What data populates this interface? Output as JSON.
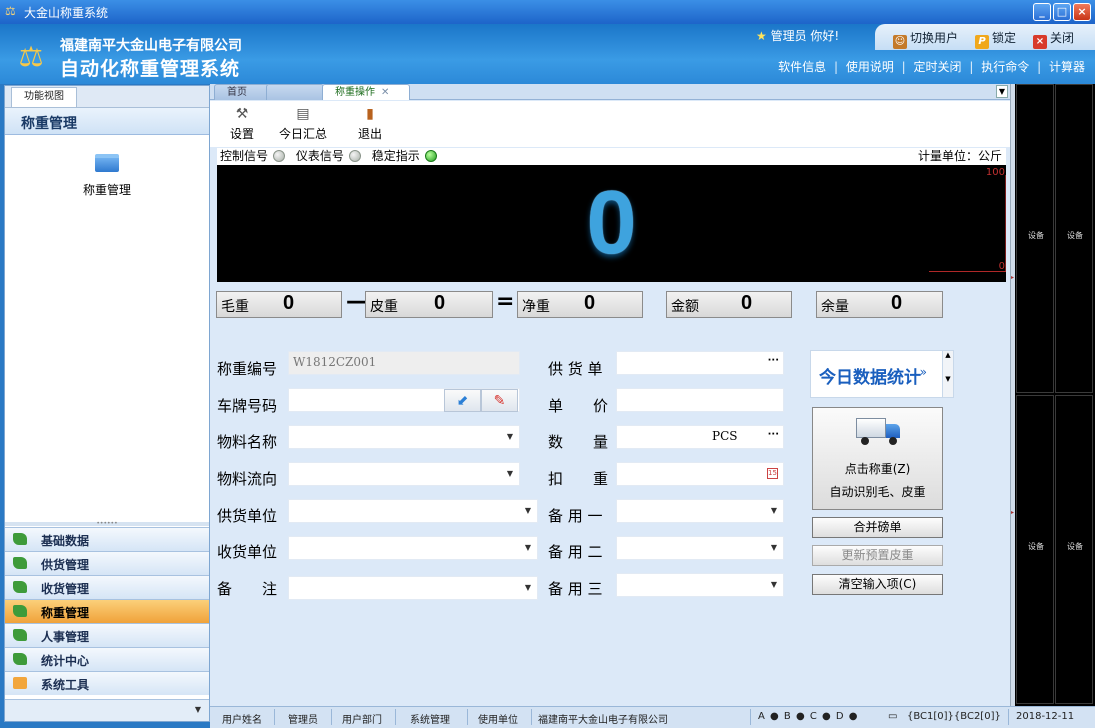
{
  "window": {
    "title": "大金山称重系统",
    "buttons": [
      "_",
      "□",
      "×"
    ]
  },
  "header": {
    "company": "福建南平大金山电子有限公司",
    "system": "自动化称重管理系统",
    "greeting": "管理员 你好!",
    "switch_user": "切换用户",
    "lock": "锁定",
    "close": "关闭",
    "links": [
      "软件信息",
      "使用说明",
      "定时关闭",
      "执行命令",
      "计算器"
    ]
  },
  "sidebar": {
    "tab": "功能视图",
    "title": "称重管理",
    "folder_label": "称重管理",
    "nav": [
      "基础数据",
      "供货管理",
      "收货管理",
      "称重管理",
      "人事管理",
      "统计中心",
      "系统工具"
    ],
    "active": "称重管理"
  },
  "tabs": [
    {
      "label": "首页"
    },
    {
      "label": "  "
    },
    {
      "label": "称重操作"
    }
  ],
  "toolbar": {
    "settings": "设置",
    "today_summary": "今日汇总",
    "exit": "退出"
  },
  "signals": {
    "control": "控制信号",
    "meter": "仪表信号",
    "stable": "稳定指示",
    "unit": "计量单位：公斤"
  },
  "display": {
    "value": "0",
    "max": "100",
    "min": "0"
  },
  "weights": {
    "gross_label": "毛重",
    "gross": "0",
    "minus": "—",
    "tare_label": "皮重",
    "tare": "0",
    "equals": "=",
    "net_label": "净重",
    "net": "0",
    "amount_label": "金额",
    "amount": "0",
    "balance_label": "余量",
    "balance": "0"
  },
  "form": {
    "weigh_no_label": "称重编号",
    "weigh_no": "W1812CZ001",
    "plate_label": "车牌号码",
    "material_label": "物料名称",
    "flow_label": "物料流向",
    "supplier_label": "供货单位",
    "receiver_label": "收货单位",
    "remark_label": "备　　注",
    "bill_label": "供 货 单",
    "price_label": "单　　价",
    "qty_label": "数　　量",
    "qty_unit": "PCS",
    "deduct_label": "扣　　重",
    "spare1_label": "备 用 一",
    "spare2_label": "备 用 二",
    "spare3_label": "备 用 三"
  },
  "actions": {
    "stats": "今日数据统计",
    "weigh_line1": "点击称重(Z)",
    "weigh_line2": "自动识别毛、皮重",
    "merge": "合并磅单",
    "update_tare": "更新预置皮重",
    "clear": "清空输入项(C)"
  },
  "statusbar": {
    "user_name": "用户姓名",
    "user": "管理员",
    "dept_label": "用户部门",
    "dept": "系统管理",
    "unit_label": "使用单位",
    "unit": "福建南平大金山电子有限公司",
    "ports": "A ● B ● C ● D ●",
    "bc": "{BC1[0]}{BC2[0]}",
    "date": "2018-12-11"
  },
  "cameras": [
    "设备",
    "设备",
    "设备",
    "设备"
  ],
  "colors": {
    "display_digit": "#3ea3de",
    "active_nav": "#f0a23a",
    "header": "#2c89d8"
  }
}
